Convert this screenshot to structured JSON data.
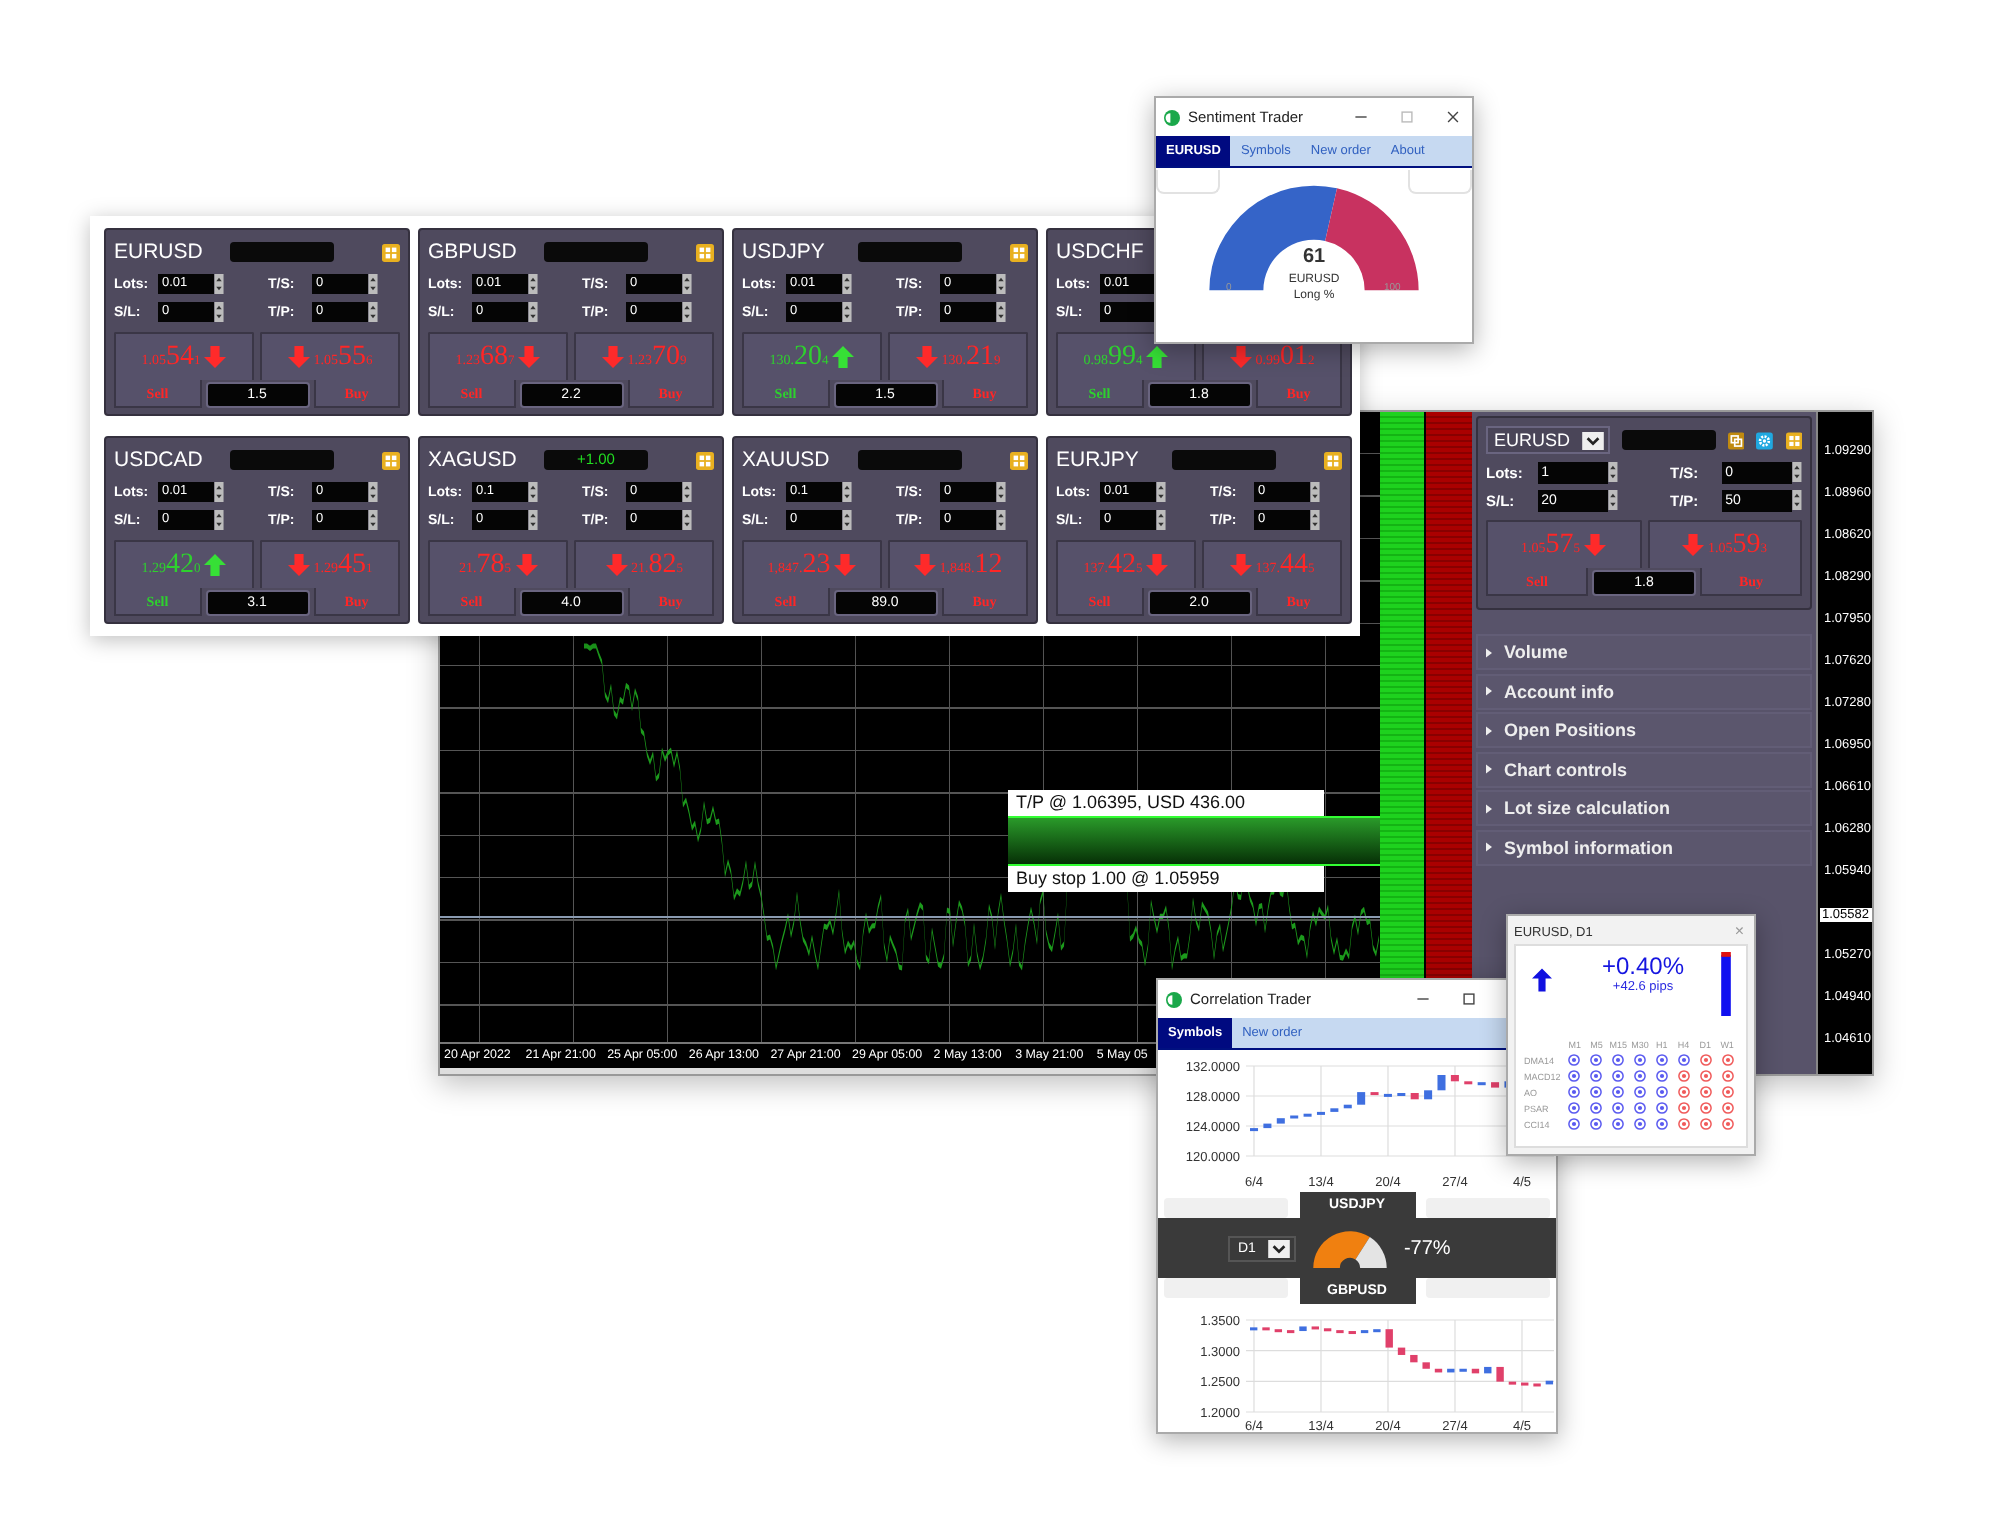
{
  "chart_window": {
    "price_axis": [
      {
        "kind": "tick",
        "label": "1.09290"
      },
      {
        "kind": "tick",
        "label": "1.08960"
      },
      {
        "kind": "tick",
        "label": "1.08620"
      },
      {
        "kind": "tick",
        "label": "1.08290"
      },
      {
        "kind": "tick",
        "label": "1.07950"
      },
      {
        "kind": "tick",
        "label": "1.07620"
      },
      {
        "kind": "tick",
        "label": "1.07280"
      },
      {
        "kind": "tick",
        "label": "1.06950"
      },
      {
        "kind": "tick",
        "label": "1.06610"
      },
      {
        "kind": "tick",
        "label": "1.06280"
      },
      {
        "kind": "tick",
        "label": "1.05940"
      },
      {
        "kind": "current",
        "label": "1.05582"
      },
      {
        "kind": "tick",
        "label": "1.05270"
      },
      {
        "kind": "tick",
        "label": "1.04940"
      },
      {
        "kind": "tick",
        "label": "1.04610"
      }
    ],
    "time_axis": [
      "20 Apr 2022",
      "21 Apr 21:00",
      "25 Apr 05:00",
      "26 Apr 13:00",
      "27 Apr 21:00",
      "29 Apr 05:00",
      "2 May 13:00",
      "3 May 21:00",
      "5 May 05"
    ],
    "orders": {
      "take_profit": "T/P @ 1.06395, USD 436.00",
      "entry": "Buy stop 1.00 @ 1.05959"
    },
    "widget": {
      "symbol": "EURUSD",
      "left": [
        {
          "label": "Lots:",
          "value": "1"
        },
        {
          "label": "S/L:",
          "value": "20"
        }
      ],
      "right": [
        {
          "label": "T/S:",
          "value": "0"
        },
        {
          "label": "T/P:",
          "value": "50"
        }
      ],
      "sell": {
        "prefix": "1.05",
        "big": "57",
        "small": "5",
        "kind": "down",
        "label": "Sell"
      },
      "buy": {
        "prefix": "1.05",
        "big": "59",
        "small": "3",
        "kind": "down",
        "label": "Buy"
      },
      "spread": "1.8"
    },
    "menu": [
      "Volume",
      "Account info",
      "Open Positions",
      "Chart controls",
      "Lot size calculation",
      "Symbol information"
    ]
  },
  "trade_panel": {
    "cards": [
      {
        "symbol": "EURUSD",
        "left": [
          {
            "label": "Lots:",
            "value": "0.01"
          },
          {
            "label": "S/L:",
            "value": "0"
          }
        ],
        "right": [
          {
            "label": "T/S:",
            "value": "0"
          },
          {
            "label": "T/P:",
            "value": "0"
          }
        ],
        "sell": {
          "prefix": "1.05",
          "big": "54",
          "small": "1",
          "kind": "down",
          "label": "Sell"
        },
        "buy": {
          "prefix": "1.05",
          "big": "55",
          "small": "6",
          "kind": "down",
          "label": "Buy"
        },
        "spread": "1.5"
      },
      {
        "symbol": "GBPUSD",
        "left": [
          {
            "label": "Lots:",
            "value": "0.01"
          },
          {
            "label": "S/L:",
            "value": "0"
          }
        ],
        "right": [
          {
            "label": "T/S:",
            "value": "0"
          },
          {
            "label": "T/P:",
            "value": "0"
          }
        ],
        "sell": {
          "prefix": "1.23",
          "big": "68",
          "small": "7",
          "kind": "down",
          "label": "Sell"
        },
        "buy": {
          "prefix": "1.23",
          "big": "70",
          "small": "9",
          "kind": "down",
          "label": "Buy"
        },
        "spread": "2.2"
      },
      {
        "symbol": "USDJPY",
        "left": [
          {
            "label": "Lots:",
            "value": "0.01"
          },
          {
            "label": "S/L:",
            "value": "0"
          }
        ],
        "right": [
          {
            "label": "T/S:",
            "value": "0"
          },
          {
            "label": "T/P:",
            "value": "0"
          }
        ],
        "sell": {
          "prefix": "130.",
          "big": "20",
          "small": "4",
          "kind": "up",
          "label": "Sell"
        },
        "buy": {
          "prefix": "130.",
          "big": "21",
          "small": "9",
          "kind": "down",
          "label": "Buy"
        },
        "spread": "1.5"
      },
      {
        "symbol": "USDCHF",
        "left": [
          {
            "label": "Lots:",
            "value": "0.01"
          },
          {
            "label": "S/L:",
            "value": "0"
          }
        ],
        "sell": {
          "prefix": "0.98",
          "big": "99",
          "small": "4",
          "kind": "up",
          "label": "Sell"
        },
        "buy": {
          "prefix": "0.99",
          "big": "01",
          "small": "2",
          "kind": "down",
          "label": "Buy"
        },
        "spread": "1.8"
      },
      {
        "symbol": "USDCAD",
        "left": [
          {
            "label": "Lots:",
            "value": "0.01"
          },
          {
            "label": "S/L:",
            "value": "0"
          }
        ],
        "right": [
          {
            "label": "T/S:",
            "value": "0"
          },
          {
            "label": "T/P:",
            "value": "0"
          }
        ],
        "sell": {
          "prefix": "1.29",
          "big": "42",
          "small": "0",
          "kind": "up",
          "label": "Sell"
        },
        "buy": {
          "prefix": "1.29",
          "big": "45",
          "small": "1",
          "kind": "down",
          "label": "Buy"
        },
        "spread": "3.1"
      },
      {
        "symbol": "XAGUSD",
        "badge_value": "+1.00",
        "left": [
          {
            "label": "Lots:",
            "value": "0.1"
          },
          {
            "label": "S/L:",
            "value": "0"
          }
        ],
        "right": [
          {
            "label": "T/S:",
            "value": "0"
          },
          {
            "label": "T/P:",
            "value": "0"
          }
        ],
        "sell": {
          "prefix": "21.",
          "big": "78",
          "small": "5",
          "kind": "down",
          "label": "Sell"
        },
        "buy": {
          "prefix": "21.",
          "big": "82",
          "small": "5",
          "kind": "down",
          "label": "Buy"
        },
        "spread": "4.0"
      },
      {
        "symbol": "XAUUSD",
        "left": [
          {
            "label": "Lots:",
            "value": "0.1"
          },
          {
            "label": "S/L:",
            "value": "0"
          }
        ],
        "right": [
          {
            "label": "T/S:",
            "value": "0"
          },
          {
            "label": "T/P:",
            "value": "0"
          }
        ],
        "sell": {
          "prefix": "1,847.",
          "big": "23",
          "kind": "down",
          "label": "Sell"
        },
        "buy": {
          "prefix": "1,848.",
          "big": "12",
          "kind": "down",
          "label": "Buy"
        },
        "spread": "89.0"
      },
      {
        "symbol": "EURJPY",
        "left": [
          {
            "label": "Lots:",
            "value": "0.01"
          },
          {
            "label": "S/L:",
            "value": "0"
          }
        ],
        "right": [
          {
            "label": "T/S:",
            "value": "0"
          },
          {
            "label": "T/P:",
            "value": "0"
          }
        ],
        "sell": {
          "prefix": "137.",
          "big": "42",
          "small": "5",
          "kind": "down",
          "label": "Sell"
        },
        "buy": {
          "prefix": "137.",
          "big": "44",
          "small": "5",
          "kind": "down",
          "label": "Buy"
        },
        "spread": "2.0"
      }
    ]
  },
  "sentiment_window": {
    "title": "Sentiment Trader",
    "tabs": [
      {
        "label": "EURUSD",
        "selected": true
      },
      {
        "label": "Symbols",
        "selected": false
      },
      {
        "label": "New order",
        "selected": false
      },
      {
        "label": "About",
        "selected": false
      }
    ],
    "gauge": {
      "level": 0.61,
      "value": "61",
      "symbol": "EURUSD",
      "caption": "Long %",
      "min": "0",
      "max": "100"
    }
  },
  "correlation_window": {
    "title": "Correlation Trader",
    "tabs": [
      {
        "label": "Symbols",
        "selected": true
      },
      {
        "label": "New order",
        "selected": false
      }
    ],
    "top_chart": {
      "y_labels": [
        "132.0000",
        "128.0000",
        "124.0000",
        "120.0000"
      ],
      "x_labels": [
        "6/4",
        "13/4",
        "20/4",
        "27/4",
        "4/5"
      ]
    },
    "top_symbol": "USDJPY",
    "timeframe": "D1",
    "gauge": {
      "level": 0.77,
      "value": "-77%"
    },
    "bottom_symbol": "GBPUSD",
    "bottom_chart": {
      "y_labels": [
        "1.3500",
        "1.3000",
        "1.2500",
        "1.2000"
      ],
      "x_labels": [
        "6/4",
        "13/4",
        "20/4",
        "27/4",
        "4/5"
      ]
    }
  },
  "signal_window": {
    "title": "EURUSD, D1",
    "close": "×",
    "change": "+0.40%",
    "pips": "+42.6 pips",
    "columns": [
      "M1",
      "M5",
      "M15",
      "M30",
      "H1",
      "H4",
      "D1",
      "W1"
    ],
    "rows": [
      {
        "label": "DMA14",
        "cells": [
          {
            "color": "#5a5af0"
          },
          {
            "color": "#5a5af0"
          },
          {
            "color": "#5a5af0"
          },
          {
            "color": "#5a5af0"
          },
          {
            "color": "#5a5af0"
          },
          {
            "color": "#5a5af0"
          },
          {
            "color": "#f05a5a"
          },
          {
            "color": "#f05a5a"
          }
        ]
      },
      {
        "label": "MACD12",
        "cells": [
          {
            "color": "#5a5af0"
          },
          {
            "color": "#5a5af0"
          },
          {
            "color": "#5a5af0"
          },
          {
            "color": "#5a5af0"
          },
          {
            "color": "#5a5af0"
          },
          {
            "color": "#f05a5a"
          },
          {
            "color": "#f05a5a"
          },
          {
            "color": "#f05a5a"
          }
        ]
      },
      {
        "label": "AO",
        "cells": [
          {
            "color": "#5a5af0"
          },
          {
            "color": "#5a5af0"
          },
          {
            "color": "#5a5af0"
          },
          {
            "color": "#5a5af0"
          },
          {
            "color": "#5a5af0"
          },
          {
            "color": "#f05a5a"
          },
          {
            "color": "#f05a5a"
          },
          {
            "color": "#f05a5a"
          }
        ]
      },
      {
        "label": "PSAR",
        "cells": [
          {
            "color": "#5a5af0"
          },
          {
            "color": "#5a5af0"
          },
          {
            "color": "#5a5af0"
          },
          {
            "color": "#5a5af0"
          },
          {
            "color": "#5a5af0"
          },
          {
            "color": "#f05a5a"
          },
          {
            "color": "#f05a5a"
          },
          {
            "color": "#f05a5a"
          }
        ]
      },
      {
        "label": "CCI14",
        "cells": [
          {
            "color": "#5a5af0"
          },
          {
            "color": "#5a5af0"
          },
          {
            "color": "#5a5af0"
          },
          {
            "color": "#5a5af0"
          },
          {
            "color": "#5a5af0"
          },
          {
            "color": "#f05a5a"
          },
          {
            "color": "#f05a5a"
          },
          {
            "color": "#f05a5a"
          }
        ]
      }
    ]
  }
}
